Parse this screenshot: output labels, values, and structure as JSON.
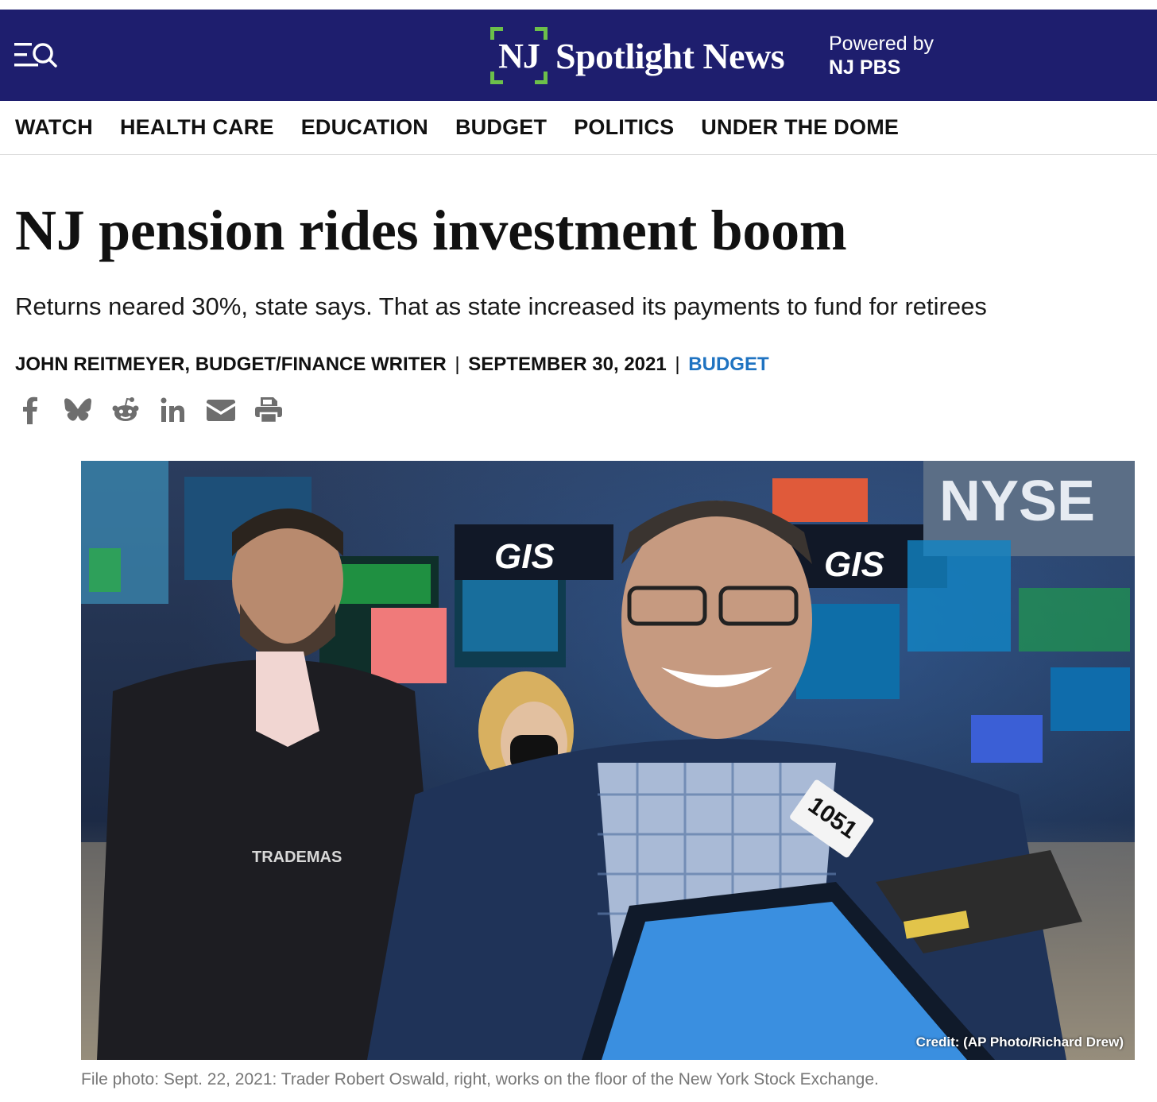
{
  "header": {
    "logo_mark": "NJ",
    "logo_text": "Spotlight News",
    "powered_by_label": "Powered by",
    "powered_by_name": "NJ PBS",
    "background_color": "#1e1e6e",
    "accent_color": "#6cc04a"
  },
  "nav": {
    "items": [
      "WATCH",
      "HEALTH CARE",
      "EDUCATION",
      "BUDGET",
      "POLITICS",
      "UNDER THE DOME"
    ]
  },
  "article": {
    "headline": "NJ pension rides investment boom",
    "dek": "Returns neared 30%, state says. That as state increased its payments to fund for retirees",
    "author": "JOHN REITMEYER, BUDGET/FINANCE WRITER",
    "separator": "|",
    "date": "SEPTEMBER 30, 2021",
    "category": "BUDGET",
    "category_color": "#1f73c1"
  },
  "share": {
    "icons": [
      "facebook-icon",
      "bluesky-icon",
      "reddit-icon",
      "linkedin-icon",
      "email-icon",
      "print-icon"
    ]
  },
  "photo": {
    "credit": "Credit: (AP Photo/Richard Drew)",
    "caption": "File photo: Sept. 22, 2021: Trader Robert Oswald, right, works on the floor of the New York Stock Exchange.",
    "badge_number": "1051",
    "jacket_text": "TRADEMAS",
    "sign_left": "GIS",
    "sign_right": "GIS",
    "sign_nyse": "NYSE"
  }
}
